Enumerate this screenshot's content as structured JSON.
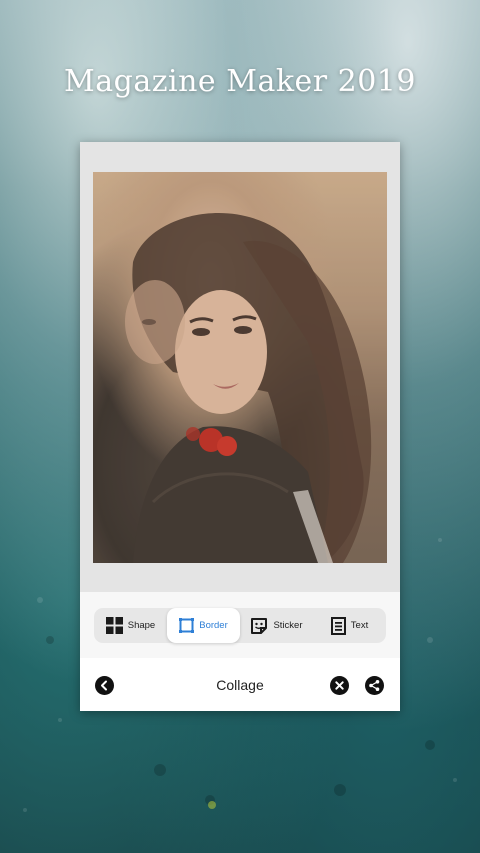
{
  "app": {
    "title": "Magazine Maker 2019"
  },
  "toolbar": {
    "items": [
      {
        "label": "Shape",
        "icon": "shape-grid-icon",
        "active": false
      },
      {
        "label": "Border",
        "icon": "border-frame-icon",
        "active": true
      },
      {
        "label": "Sticker",
        "icon": "sticker-icon",
        "active": false
      },
      {
        "label": "Text",
        "icon": "text-document-icon",
        "active": false
      }
    ]
  },
  "bottom_bar": {
    "title": "Collage",
    "back_icon": "chevron-left-icon",
    "close_icon": "close-circle-icon",
    "share_icon": "share-icon"
  },
  "colors": {
    "accent": "#2e7fd6",
    "card": "#ffffff",
    "canvas": "#e4e4e4",
    "toolbar": "#e7e7e7"
  }
}
